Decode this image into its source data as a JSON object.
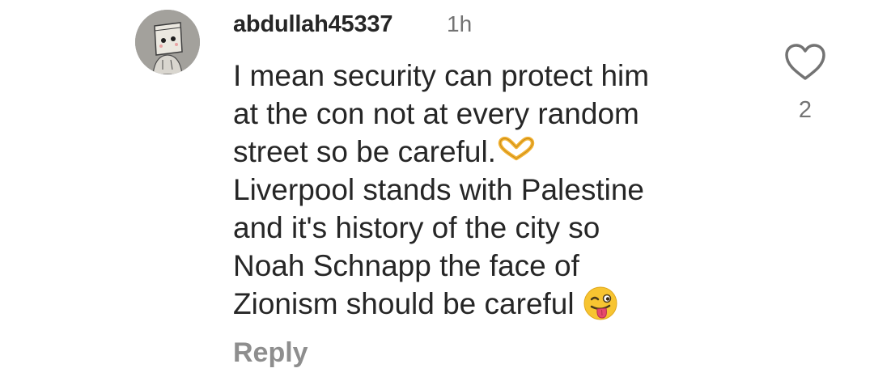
{
  "comment": {
    "username": "abdullah45337",
    "time_ago": "1h",
    "lines": [
      "I mean security can protect him",
      "at the con not at every random",
      "street so be careful.",
      "Liverpool stands with Palestine",
      "and it's history of the city so",
      "Noah Schnapp the face of",
      "Zionism should be careful"
    ],
    "emojis": {
      "heart_hands": "heart-hands-emoji",
      "winking_tongue": "winking-tongue-emoji"
    },
    "reply_label": "Reply",
    "like_count": "2",
    "like_icon": "heart-outline-icon",
    "colors": {
      "text": "#262626",
      "secondary": "#737373",
      "reply": "#8e8e8e"
    }
  }
}
